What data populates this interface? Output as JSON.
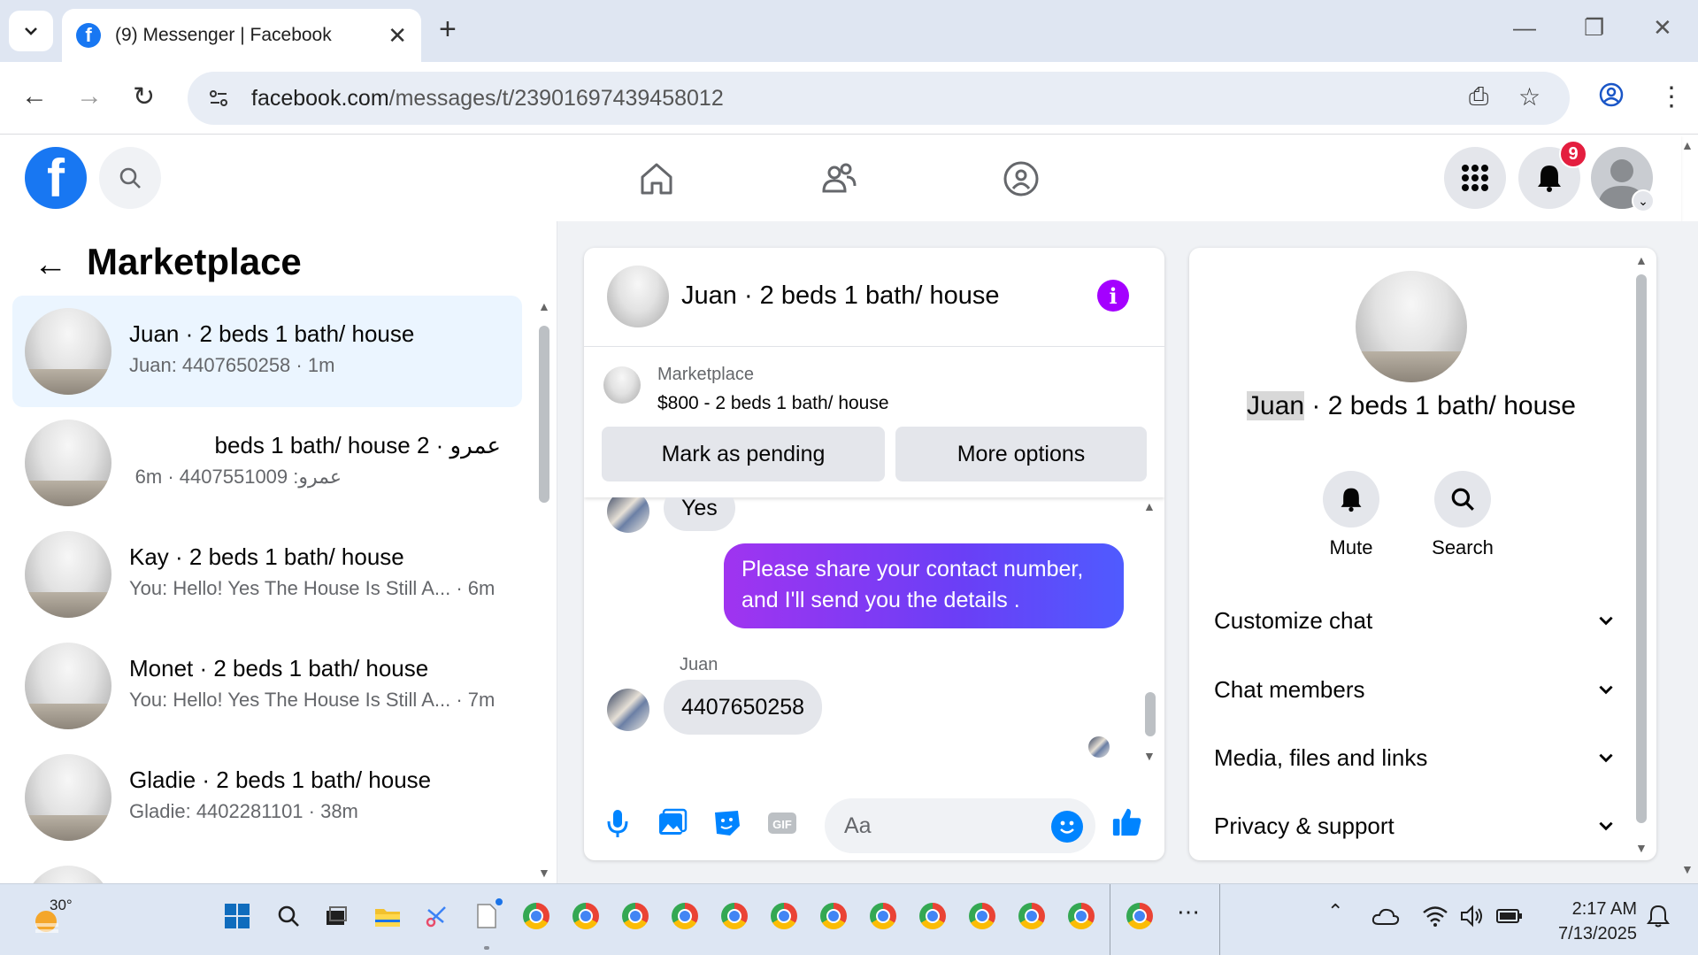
{
  "browser": {
    "tab_title": "(9) Messenger | Facebook",
    "url_domain": "facebook.com",
    "url_path": "/messages/t/23901697439458012"
  },
  "header": {
    "notification_count": "9"
  },
  "left_panel": {
    "title": "Marketplace",
    "conversations": [
      {
        "title": "Juan · 2 beds 1 bath/ house",
        "subtitle": "Juan: 4407650258 · 1m",
        "active": true
      },
      {
        "title": "عمرو · 2 beds 1 bath/ house",
        "subtitle": "عمرو: 4407551009 · 6m",
        "active": false
      },
      {
        "title": "Kay · 2 beds 1 bath/ house",
        "subtitle": "You: Hello! Yes The House Is Still A... · 6m",
        "active": false
      },
      {
        "title": "Monet · 2 beds 1 bath/ house",
        "subtitle": "You: Hello! Yes The House Is Still A... · 7m",
        "active": false
      },
      {
        "title": "Gladie · 2 beds 1 bath/ house",
        "subtitle": "Gladie: 4402281101 · 38m",
        "active": false
      }
    ]
  },
  "chat": {
    "title": "Juan · 2 beds 1 bath/ house",
    "marketplace_label": "Marketplace",
    "listing": "$800 - 2 beds 1 bath/ house",
    "mark_pending": "Mark as pending",
    "more_options": "More options",
    "messages": {
      "first_in": "Yes",
      "out": "Please share your contact number, and I'll send you the details .",
      "sender_name": "Juan",
      "second_in": "4407650258"
    },
    "composer_placeholder": "Aa"
  },
  "right_panel": {
    "title_name": "Juan",
    "title_rest": " · 2 beds 1 bath/ house",
    "mute_label": "Mute",
    "search_label": "Search",
    "rows": [
      "Customize chat",
      "Chat members",
      "Media, files and links",
      "Privacy & support"
    ]
  },
  "taskbar": {
    "weather_temp": "30°",
    "time": "2:17 AM",
    "date": "7/13/2025"
  },
  "colors": {
    "facebook_blue": "#1877f2",
    "active_conv_bg": "#ebf5ff",
    "outgoing_bubble_start": "#a034f0",
    "outgoing_bubble_end": "#4f5bff",
    "info_purple": "#a400ff",
    "badge_red": "#e41e3f"
  }
}
